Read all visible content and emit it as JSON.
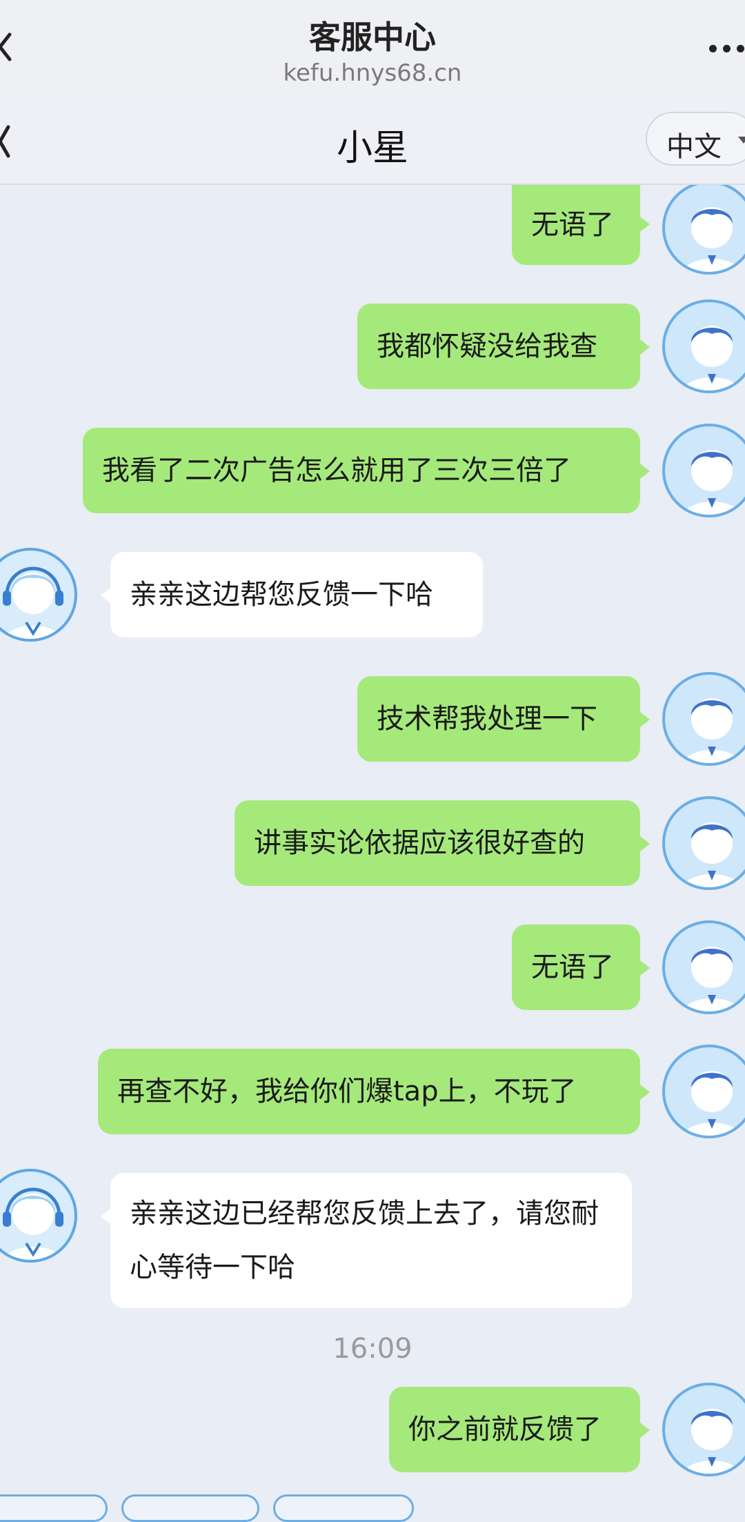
{
  "browser": {
    "title": "客服中心",
    "url": "kefu.hnys68.cn"
  },
  "chat": {
    "title": "小星",
    "language": "中文"
  },
  "messages": [
    {
      "from": "user",
      "text": "无语了"
    },
    {
      "from": "user",
      "text": "我都怀疑没给我查"
    },
    {
      "from": "user",
      "text": "我看了二次广告怎么就用了三次三倍了"
    },
    {
      "from": "agent",
      "text": "亲亲这边帮您反馈一下哈"
    },
    {
      "from": "user",
      "text": "技术帮我处理一下"
    },
    {
      "from": "user",
      "text": "讲事实论依据应该很好查的"
    },
    {
      "from": "user",
      "text": "无语了"
    },
    {
      "from": "user",
      "text": "再查不好，我给你们爆tap上，不玩了"
    },
    {
      "from": "agent",
      "text": "亲亲这边已经帮您反馈上去了，请您耐心等待一下哈"
    },
    {
      "from": "user",
      "text": "你之前就反馈了"
    }
  ],
  "timestamp": "16:09",
  "colors": {
    "user_bubble": "#a6e97b",
    "agent_bubble": "#ffffff",
    "background": "#e9edf5"
  },
  "icons": {
    "back": "chevron-left-icon",
    "more": "more-dots-icon",
    "language_caret": "caret-down-icon",
    "user_avatar": "user-avatar-icon",
    "agent_avatar": "agent-headset-avatar-icon"
  }
}
